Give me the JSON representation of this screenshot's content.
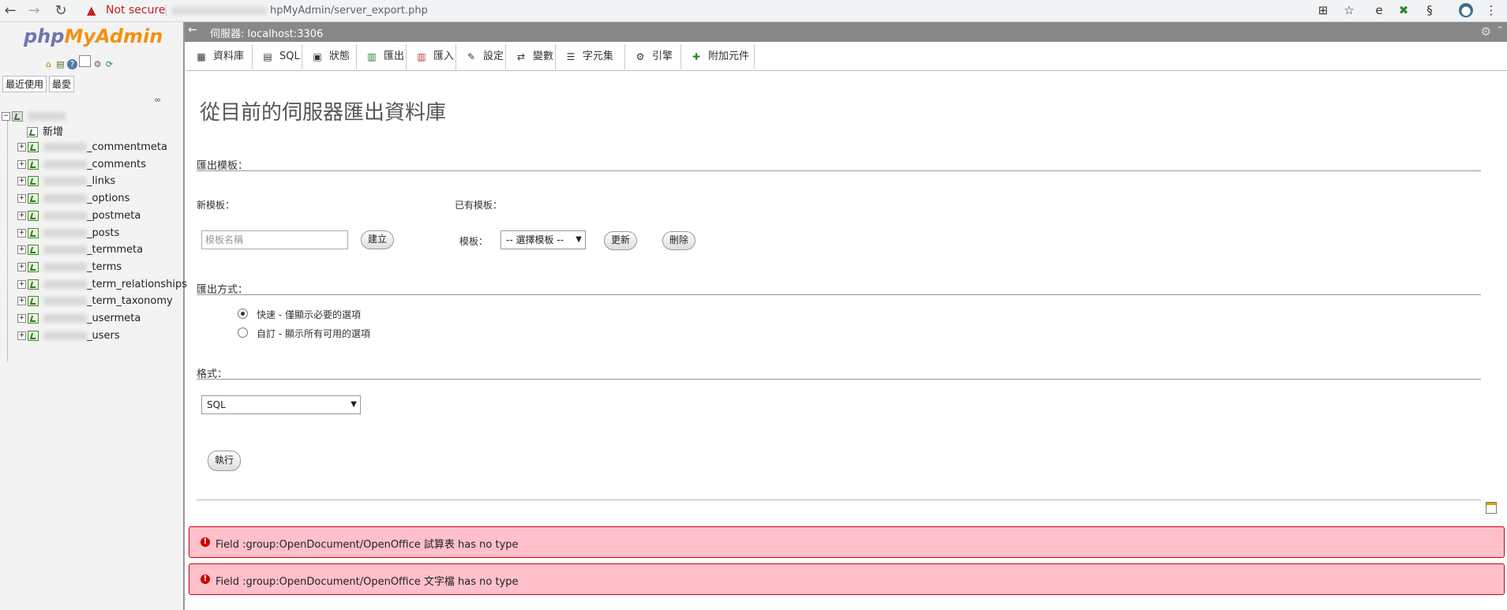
{
  "browser": {
    "not_secure": "Not secure",
    "url_visible": "hpMyAdmin/server_export.php"
  },
  "left": {
    "logo_php": "php",
    "logo_myadmin": "MyAdmin",
    "recent_tab": "最近使用",
    "favorites_tab": "最愛",
    "new_label": "新增",
    "tables": [
      "_commentmeta",
      "_comments",
      "_links",
      "_options",
      "_postmeta",
      "_posts",
      "_termmeta",
      "_terms",
      "_term_relationships",
      "_term_taxonomy",
      "_usermeta",
      "_users"
    ]
  },
  "server": {
    "label": "伺服器: localhost:3306"
  },
  "tabs": [
    "資料庫",
    "SQL",
    "狀態",
    "匯出",
    "匯入",
    "設定",
    "變數",
    "字元集",
    "引擎",
    "附加元件"
  ],
  "main": {
    "title": "從目前的伺服器匯出資料庫",
    "template_section": "匯出模板：",
    "new_template_label": "新模板：",
    "existing_template_label": "已有模板：",
    "template_name_placeholder": "模板名稱",
    "create_button": "建立",
    "template_label": "模板：",
    "template_select_value": "-- 選擇模板 --",
    "update_button": "更新",
    "delete_button": "刪除",
    "method_section": "匯出方式：",
    "method_quick": "快速 - 僅顯示必要的選項",
    "method_custom": "自訂 - 顯示所有可用的選項",
    "format_section": "格式：",
    "format_value": "SQL",
    "go_button": "執行"
  },
  "errors": [
    "Field :group:OpenDocument/OpenOffice 試算表 has no type",
    "Field :group:OpenDocument/OpenOffice 文字檔 has no type"
  ]
}
